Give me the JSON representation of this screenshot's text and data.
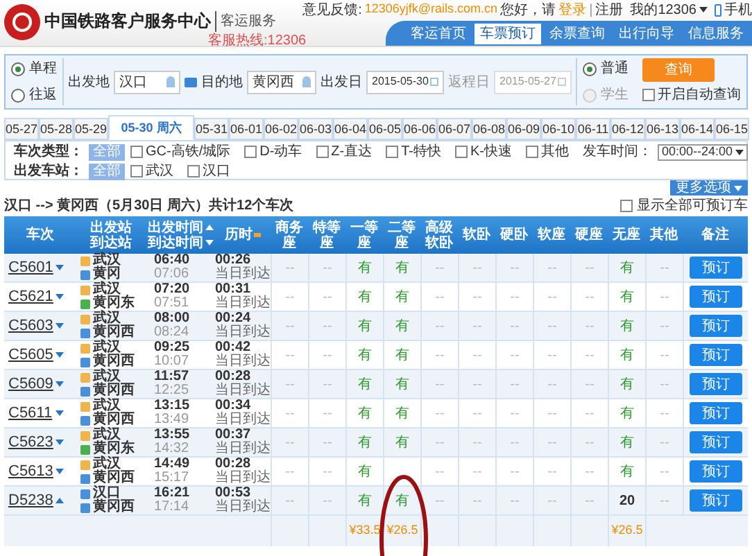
{
  "header": {
    "title": "中国铁路客户服务中心",
    "subtitle": "客运服务",
    "hotline": "客服热线:12306",
    "feedback_label": "意见反馈:",
    "feedback_email": "12306yjfk@rails.com.cn",
    "greeting": "您好，请",
    "login": "登录",
    "separator": "|",
    "register": "注册",
    "my_account": "我的12306",
    "mobile": "手机",
    "nav": [
      {
        "label": "客运首页",
        "selected": false
      },
      {
        "label": "车票预订",
        "selected": true
      },
      {
        "label": "余票查询",
        "selected": false
      },
      {
        "label": "出行向导",
        "selected": false
      },
      {
        "label": "信息服务",
        "selected": false
      }
    ]
  },
  "search": {
    "trip_types": [
      {
        "label": "单程",
        "selected": true
      },
      {
        "label": "往返",
        "selected": false
      }
    ],
    "from_label": "出发地",
    "from": "汉口",
    "to_label": "目的地",
    "to": "黄冈西",
    "date_label": "出发日",
    "date": "2015-05-30",
    "return_label": "返程日",
    "return_date": "2015-05-27",
    "passenger_types": [
      {
        "label": "普通",
        "selected": true,
        "disabled": false
      },
      {
        "label": "学生",
        "selected": false,
        "disabled": true
      }
    ],
    "query_button": "查询",
    "auto_query": {
      "label": "开启自动查询",
      "checked": false
    }
  },
  "dates": [
    {
      "label": "05-27",
      "selected": false
    },
    {
      "label": "05-28",
      "selected": false
    },
    {
      "label": "05-29",
      "selected": false
    },
    {
      "label": "05-30 周六",
      "selected": true
    },
    {
      "label": "05-31",
      "selected": false
    },
    {
      "label": "06-01",
      "selected": false
    },
    {
      "label": "06-02",
      "selected": false
    },
    {
      "label": "06-03",
      "selected": false
    },
    {
      "label": "06-04",
      "selected": false
    },
    {
      "label": "06-05",
      "selected": false
    },
    {
      "label": "06-06",
      "selected": false
    },
    {
      "label": "06-07",
      "selected": false
    },
    {
      "label": "06-08",
      "selected": false
    },
    {
      "label": "06-09",
      "selected": false
    },
    {
      "label": "06-10",
      "selected": false
    },
    {
      "label": "06-11",
      "selected": false
    },
    {
      "label": "06-12",
      "selected": false
    },
    {
      "label": "06-13",
      "selected": false
    },
    {
      "label": "06-14",
      "selected": false
    },
    {
      "label": "06-15",
      "selected": false
    }
  ],
  "filters": {
    "type_label": "车次类型：",
    "types": [
      {
        "label": "全部",
        "kind": "chip",
        "checked": true
      },
      {
        "label": "GC-高铁/城际",
        "kind": "checkbox",
        "checked": false
      },
      {
        "label": "D-动车",
        "kind": "checkbox",
        "checked": false
      },
      {
        "label": "Z-直达",
        "kind": "checkbox",
        "checked": false
      },
      {
        "label": "T-特快",
        "kind": "checkbox",
        "checked": false
      },
      {
        "label": "K-快速",
        "kind": "checkbox",
        "checked": false
      },
      {
        "label": "其他",
        "kind": "checkbox",
        "checked": false
      }
    ],
    "time_label": "发车时间：",
    "time_value": "00:00--24:00",
    "station_label": "出发车站：",
    "stations": [
      {
        "label": "全部",
        "kind": "chip",
        "checked": true
      },
      {
        "label": "武汉",
        "kind": "checkbox",
        "checked": false
      },
      {
        "label": "汉口",
        "kind": "checkbox",
        "checked": false
      }
    ],
    "more_button": "更多选项"
  },
  "summary": {
    "text": "汉口 --> 黄冈西（5月30日  周六）共计**12**个车次",
    "show_all": {
      "label": "显示全部可预订车",
      "checked": false
    }
  },
  "table": {
    "columns": [
      {
        "top": "车次"
      },
      {
        "top": "出发站",
        "bottom": "到达站"
      },
      {
        "top": "出发时间",
        "bottom": "到达时间"
      },
      {
        "top": "历时"
      },
      {
        "top": "商务座"
      },
      {
        "top": "特等座"
      },
      {
        "top": "一等座"
      },
      {
        "top": "二等座"
      },
      {
        "top": "高级软卧"
      },
      {
        "top": "软卧"
      },
      {
        "top": "硬卧"
      },
      {
        "top": "软座"
      },
      {
        "top": "硬座"
      },
      {
        "top": "无座"
      },
      {
        "top": "其他"
      },
      {
        "top": "备注"
      }
    ],
    "rows": [
      {
        "train": "C5601",
        "expanded": false,
        "from": {
          "name": "武汉",
          "kind": "start"
        },
        "to": {
          "name": "黄冈",
          "kind": "pass"
        },
        "depart": "06:40",
        "arrive": "07:06",
        "duration": "00:26",
        "arrival_day": "当日到达",
        "seats": {
          "business": "--",
          "premium": "--",
          "first": "有",
          "second": "有",
          "deluxe_sleeper": "--",
          "soft_sleeper": "--",
          "hard_sleeper": "--",
          "soft_seat": "--",
          "hard_seat": "--",
          "no_seat": "有",
          "other": "--"
        },
        "action": "预订"
      },
      {
        "train": "C5621",
        "expanded": false,
        "from": {
          "name": "武汉",
          "kind": "start"
        },
        "to": {
          "name": "黄冈东",
          "kind": "end"
        },
        "depart": "07:20",
        "arrive": "07:51",
        "duration": "00:31",
        "arrival_day": "当日到达",
        "seats": {
          "business": "--",
          "premium": "--",
          "first": "有",
          "second": "有",
          "deluxe_sleeper": "--",
          "soft_sleeper": "--",
          "hard_sleeper": "--",
          "soft_seat": "--",
          "hard_seat": "--",
          "no_seat": "有",
          "other": "--"
        },
        "action": "预订"
      },
      {
        "train": "C5603",
        "expanded": false,
        "from": {
          "name": "武汉",
          "kind": "start"
        },
        "to": {
          "name": "黄冈西",
          "kind": "pass"
        },
        "depart": "08:00",
        "arrive": "08:24",
        "duration": "00:24",
        "arrival_day": "当日到达",
        "seats": {
          "business": "--",
          "premium": "--",
          "first": "有",
          "second": "有",
          "deluxe_sleeper": "--",
          "soft_sleeper": "--",
          "hard_sleeper": "--",
          "soft_seat": "--",
          "hard_seat": "--",
          "no_seat": "有",
          "other": "--"
        },
        "action": "预订"
      },
      {
        "train": "C5605",
        "expanded": false,
        "from": {
          "name": "武汉",
          "kind": "start"
        },
        "to": {
          "name": "黄冈西",
          "kind": "pass"
        },
        "depart": "09:25",
        "arrive": "10:07",
        "duration": "00:42",
        "arrival_day": "当日到达",
        "seats": {
          "business": "--",
          "premium": "--",
          "first": "有",
          "second": "有",
          "deluxe_sleeper": "--",
          "soft_sleeper": "--",
          "hard_sleeper": "--",
          "soft_seat": "--",
          "hard_seat": "--",
          "no_seat": "有",
          "other": "--"
        },
        "action": "预订"
      },
      {
        "train": "C5609",
        "expanded": false,
        "from": {
          "name": "武汉",
          "kind": "start"
        },
        "to": {
          "name": "黄冈西",
          "kind": "pass"
        },
        "depart": "11:57",
        "arrive": "12:25",
        "duration": "00:28",
        "arrival_day": "当日到达",
        "seats": {
          "business": "--",
          "premium": "--",
          "first": "有",
          "second": "有",
          "deluxe_sleeper": "--",
          "soft_sleeper": "--",
          "hard_sleeper": "--",
          "soft_seat": "--",
          "hard_seat": "--",
          "no_seat": "有",
          "other": "--"
        },
        "action": "预订"
      },
      {
        "train": "C5611",
        "expanded": false,
        "from": {
          "name": "武汉",
          "kind": "start"
        },
        "to": {
          "name": "黄冈西",
          "kind": "pass"
        },
        "depart": "13:15",
        "arrive": "13:49",
        "duration": "00:34",
        "arrival_day": "当日到达",
        "seats": {
          "business": "--",
          "premium": "--",
          "first": "有",
          "second": "有",
          "deluxe_sleeper": "--",
          "soft_sleeper": "--",
          "hard_sleeper": "--",
          "soft_seat": "--",
          "hard_seat": "--",
          "no_seat": "有",
          "other": "--"
        },
        "action": "预订"
      },
      {
        "train": "C5623",
        "expanded": false,
        "from": {
          "name": "武汉",
          "kind": "start"
        },
        "to": {
          "name": "黄冈东",
          "kind": "end"
        },
        "depart": "13:55",
        "arrive": "14:32",
        "duration": "00:37",
        "arrival_day": "当日到达",
        "seats": {
          "business": "--",
          "premium": "--",
          "first": "有",
          "second": "有",
          "deluxe_sleeper": "--",
          "soft_sleeper": "--",
          "hard_sleeper": "--",
          "soft_seat": "--",
          "hard_seat": "--",
          "no_seat": "有",
          "other": "--"
        },
        "action": "预订"
      },
      {
        "train": "C5613",
        "expanded": false,
        "from": {
          "name": "武汉",
          "kind": "start"
        },
        "to": {
          "name": "黄冈西",
          "kind": "pass"
        },
        "depart": "14:49",
        "arrive": "15:17",
        "duration": "00:28",
        "arrival_day": "当日到达",
        "seats": {
          "business": "--",
          "premium": "--",
          "first": "有",
          "deluxe_sleeper": "--",
          "soft_sleeper": "--",
          "hard_sleeper": "--",
          "soft_seat": "--",
          "hard_seat": "--",
          "no_seat": "有",
          "other": "--"
        },
        "action": "预订"
      },
      {
        "train": "D5238",
        "expanded": true,
        "from": {
          "name": "汉口",
          "kind": "pass"
        },
        "to": {
          "name": "黄冈西",
          "kind": "pass"
        },
        "depart": "16:21",
        "arrive": "17:14",
        "duration": "00:53",
        "arrival_day": "当日到达",
        "seats": {
          "business": "--",
          "premium": "--",
          "first": "有",
          "second": "有",
          "deluxe_sleeper": "--",
          "soft_sleeper": "--",
          "hard_sleeper": "--",
          "soft_seat": "--",
          "hard_seat": "--",
          "no_seat": "20",
          "other": "--"
        },
        "action": "预订"
      }
    ],
    "prices": {
      "first": "¥33.5",
      "second": "¥26.5",
      "no_seat": "¥26.5"
    }
  }
}
